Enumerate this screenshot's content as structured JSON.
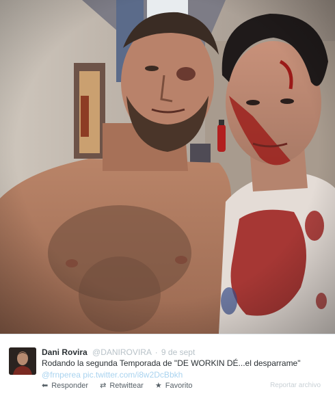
{
  "photo": {
    "description_icon": "photo-image"
  },
  "tweet": {
    "author_name": "Dani Rovira",
    "author_handle": "@DANIROVIRA",
    "separator": "·",
    "timestamp": "9 de sept",
    "text": "Rodando la segunda Temporada de \"DE WORKIN DÉ...el desparrame\"",
    "mention": "@frnperea",
    "link": "pic.twitter.com/i8w2DcBbkh",
    "report_label": "Reportar archivo",
    "actions": [
      {
        "icon": "reply-icon",
        "glyph": "⬅",
        "label": "Responder"
      },
      {
        "icon": "retweet-icon",
        "glyph": "⇄",
        "label": "Retwittear"
      },
      {
        "icon": "star-icon",
        "glyph": "★",
        "label": "Favorito"
      }
    ]
  },
  "colors": {
    "link": "#a9d3ef",
    "name": "#292f33",
    "muted": "#b8c2c8",
    "blood": "#9b1a18"
  }
}
